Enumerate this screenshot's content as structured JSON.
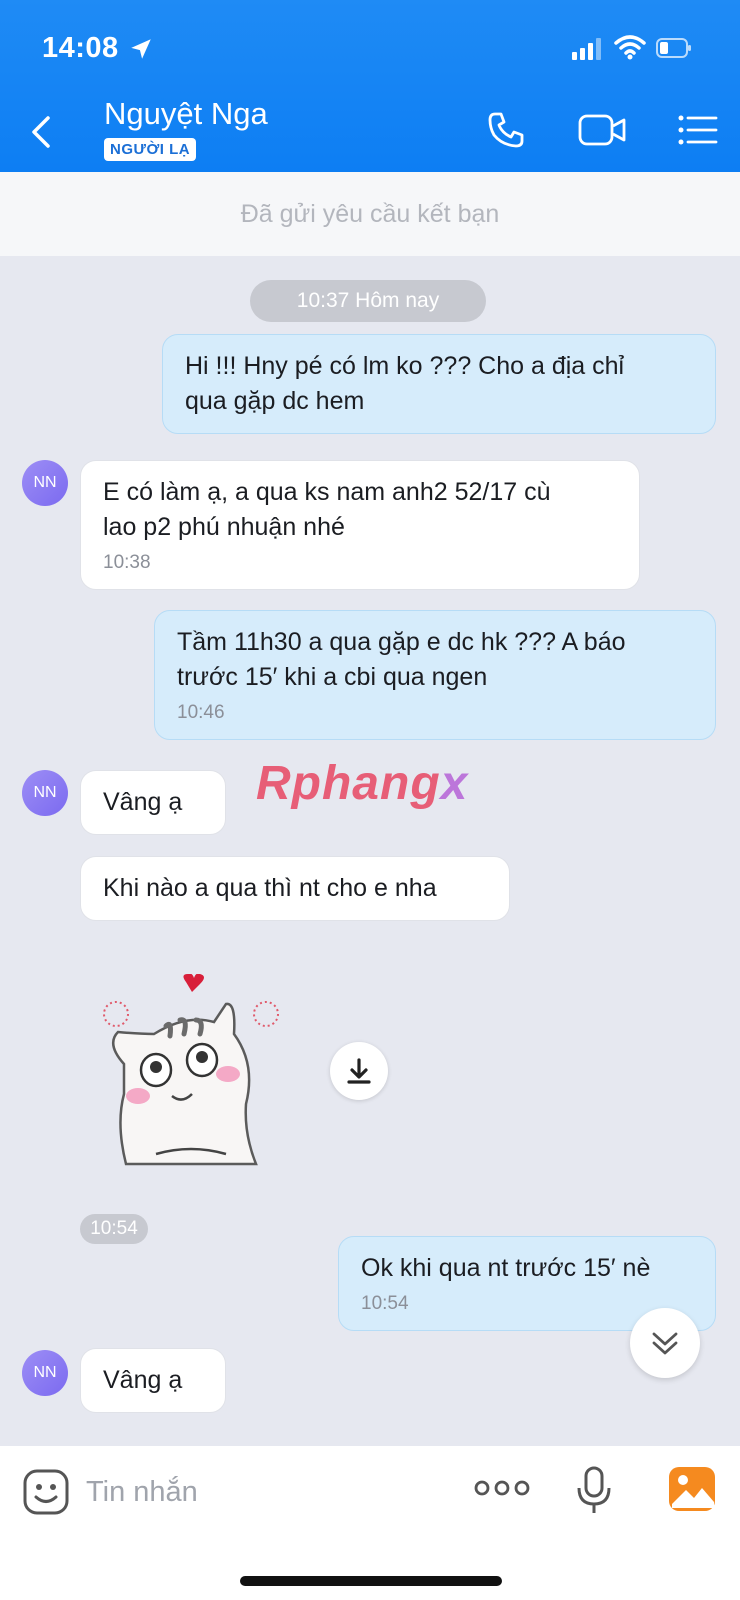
{
  "status_bar": {
    "time": "14:08"
  },
  "header": {
    "contact_name": "Nguyệt Nga",
    "badge": "NGƯỜI LẠ"
  },
  "friend_request_text": "Đã gửi yêu cầu kết bạn",
  "chat": {
    "date_separator": "10:37 Hôm nay",
    "avatar_initials": "NN",
    "messages": [
      {
        "dir": "out",
        "lines": [
          "Hi !!! Hny pé có lm ko ??? Cho a địa chỉ",
          "qua gặp dc hem"
        ],
        "time": ""
      },
      {
        "dir": "in",
        "lines": [
          "E có làm ạ, a qua ks nam anh2 52/17 cù",
          "lao p2 phú nhuận nhé"
        ],
        "time": "10:38"
      },
      {
        "dir": "out",
        "lines": [
          "Tầm 11h30 a qua gặp e dc hk ??? A báo",
          "trước 15′ khi a cbi qua ngen"
        ],
        "time": "10:46"
      },
      {
        "dir": "in",
        "lines": [
          "Vâng ạ"
        ],
        "time": ""
      },
      {
        "dir": "in",
        "lines": [
          "Khi nào a qua thì nt cho e nha"
        ],
        "time": ""
      },
      {
        "dir": "out",
        "lines": [
          "Ok khi qua nt trước 15′ nè"
        ],
        "time": "10:54"
      },
      {
        "dir": "in",
        "lines": [
          "Vâng ạ"
        ],
        "time": ""
      }
    ],
    "sticker_time": "10:54",
    "watermark": {
      "main": "Rphang",
      "tail": "x"
    }
  },
  "composer": {
    "placeholder": "Tin nhắn"
  },
  "colors": {
    "header": "#0d7ef3",
    "outgoing_bubble": "#d6ecfb",
    "incoming_bubble": "#ffffff",
    "avatar": "#8b7cf2"
  }
}
